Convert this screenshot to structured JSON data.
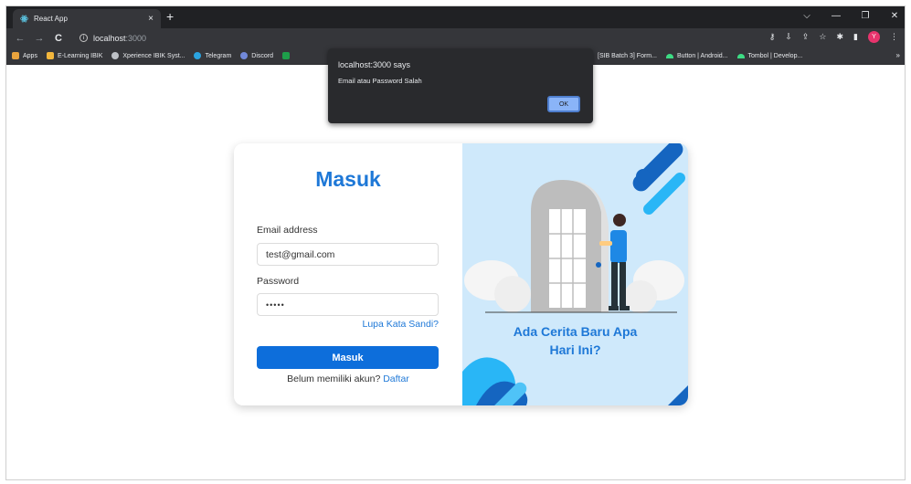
{
  "browser": {
    "tab_title": "React App",
    "tab_close": "×",
    "new_tab": "+",
    "url_host": "localhost",
    "url_port": ":3000"
  },
  "bookmarks": {
    "left": [
      {
        "label": "Apps",
        "icon": "apps-grid-icon",
        "color": "#e8a33d"
      },
      {
        "label": "E-Learning IBIK",
        "icon": "elearning-icon",
        "color": "#f2b63c"
      },
      {
        "label": "Xperience IBIK Syst...",
        "icon": "globe-icon",
        "color": "#bdc1c6"
      },
      {
        "label": "Telegram",
        "icon": "telegram-icon",
        "color": "#2aa3e0"
      },
      {
        "label": "Discord",
        "icon": "discord-icon",
        "color": "#7289da"
      }
    ],
    "right": [
      {
        "label": "[SIB Batch 3] Form...",
        "icon": "",
        "color": ""
      },
      {
        "label": "Button | Android...",
        "icon": "android-icon",
        "color": "#3ddc84"
      },
      {
        "label": "Tombol | Develop...",
        "icon": "android-icon",
        "color": "#3ddc84"
      }
    ],
    "more": "»"
  },
  "alert": {
    "title": "localhost:3000 says",
    "message": "Email atau Password Salah",
    "ok_label": "OK"
  },
  "login": {
    "heading": "Masuk",
    "email_label": "Email address",
    "email_value": "test@gmail.com",
    "password_label": "Password",
    "password_value": "•••••",
    "forgot_label": "Lupa Kata Sandi?",
    "submit_label": "Masuk",
    "signup_text": "Belum memiliki akun?",
    "signup_link": "Daftar"
  },
  "illustration": {
    "tagline_line1": "Ada Cerita Baru Apa",
    "tagline_line2": "Hari Ini?"
  },
  "colors": {
    "accent": "#1e78d7",
    "button": "#0d6edb",
    "panel_bg": "#cfe9fb"
  }
}
